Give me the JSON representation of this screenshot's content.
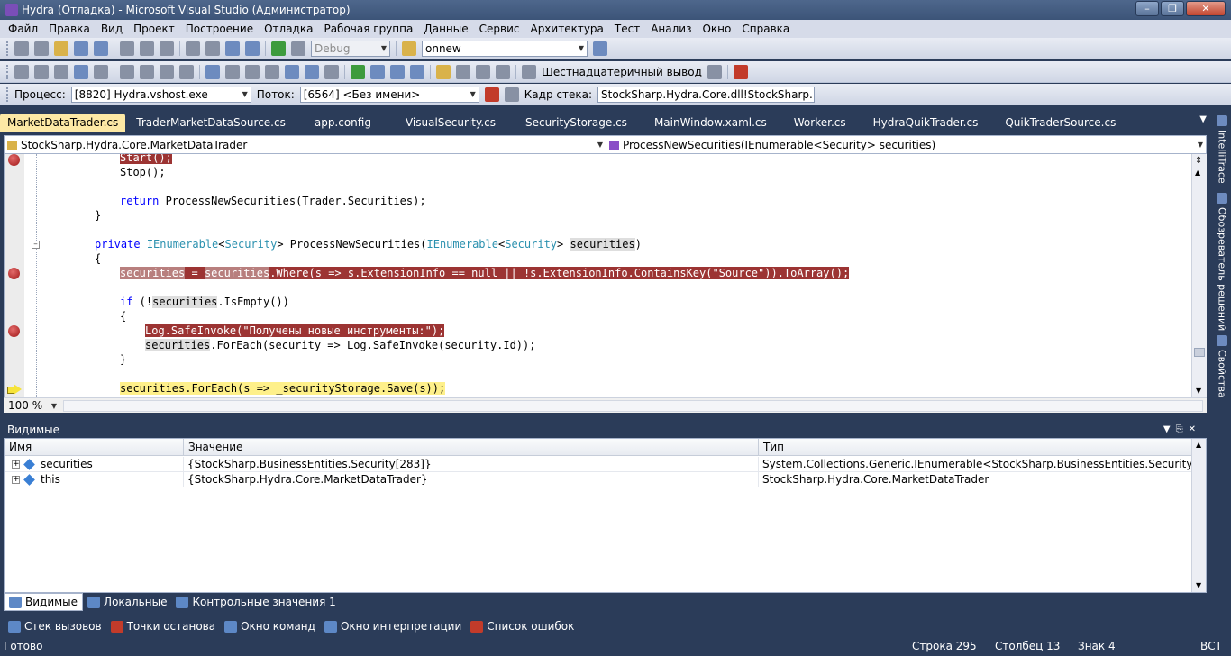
{
  "window": {
    "title": "Hydra (Отладка) - Microsoft Visual Studio (Администратор)"
  },
  "menu": [
    "Файл",
    "Правка",
    "Вид",
    "Проект",
    "Построение",
    "Отладка",
    "Рабочая группа",
    "Данные",
    "Сервис",
    "Архитектура",
    "Тест",
    "Анализ",
    "Окно",
    "Справка"
  ],
  "toolbar1": {
    "config": "Debug",
    "search": "onnew"
  },
  "toolbar2": {
    "hex_label": "Шестнадцатеричный вывод"
  },
  "toolbar3": {
    "process_label": "Процесс:",
    "process": "[8820] Hydra.vshost.exe",
    "thread_label": "Поток:",
    "thread": "[6564] <Без имени>",
    "stack_label": "Кадр стека:",
    "stack": "StockSharp.Hydra.Core.dll!StockSharp.Hydr"
  },
  "tabs": [
    "MarketDataTrader.cs",
    "TraderMarketDataSource.cs",
    "app.config",
    "VisualSecurity.cs",
    "SecurityStorage.cs",
    "MainWindow.xaml.cs",
    "Worker.cs",
    "HydraQuikTrader.cs",
    "QuikTraderSource.cs"
  ],
  "nav": {
    "type": "StockSharp.Hydra.Core.MarketDataTrader",
    "member": "ProcessNewSecurities(IEnumerable<Security> securities)"
  },
  "code": {
    "l1": "Start();",
    "l2": "Stop();",
    "l3_kw": "return",
    "l3_rest": " ProcessNewSecurities(Trader.Securities);",
    "l4": "}",
    "l5_kw": "private",
    "l5_t1": "IEnumerable",
    "l5_a": "<",
    "l5_t2": "Security",
    "l5_b": "> ProcessNewSecurities(",
    "l5_t3": "IEnumerable",
    "l5_c": "<",
    "l5_t4": "Security",
    "l5_d": "> ",
    "l5_e": "securities",
    "l5_f": ")",
    "l6": "{",
    "l7_a": "securities",
    "l7_b": " = ",
    "l7_c": "securities",
    "l7_d": ".Where(s => s.ExtensionInfo == null || !s.ExtensionInfo.ContainsKey(\"Source\")).ToArray();",
    "l8_kw": "if",
    "l8_a": " (!",
    "l8_b": "securities",
    "l8_c": ".IsEmpty())",
    "l9": "{",
    "l10": "Log.SafeInvoke(\"Получены новые инструменты:\");",
    "l11_a": "securities",
    "l11_b": ".ForEach(security => Log.SafeInvoke(security.Id));",
    "l12": "}",
    "l13": "securities.ForEach(s => _securityStorage.Save(s));"
  },
  "zoom": "100 %",
  "watch": {
    "title": "Видимые",
    "headers": [
      "Имя",
      "Значение",
      "Тип"
    ],
    "rows": [
      {
        "name": "securities",
        "value": "{StockSharp.BusinessEntities.Security[283]}",
        "type": "System.Collections.Generic.IEnumerable<StockSharp.BusinessEntities.Security> {StockSha"
      },
      {
        "name": "this",
        "value": "{StockSharp.Hydra.Core.MarketDataTrader}",
        "type": "StockSharp.Hydra.Core.MarketDataTrader"
      }
    ]
  },
  "panel_tabs1": [
    "Видимые",
    "Локальные",
    "Контрольные значения 1"
  ],
  "panel_tabs2": [
    "Стек вызовов",
    "Точки останова",
    "Окно команд",
    "Окно интерпретации",
    "Список ошибок"
  ],
  "right_dock": [
    "IntelliTrace",
    "Обозреватель решений",
    "Свойства"
  ],
  "status": {
    "ready": "Готово",
    "line": "Строка 295",
    "col": "Столбец 13",
    "ch": "Знак 4",
    "mode": "ВСТ"
  }
}
